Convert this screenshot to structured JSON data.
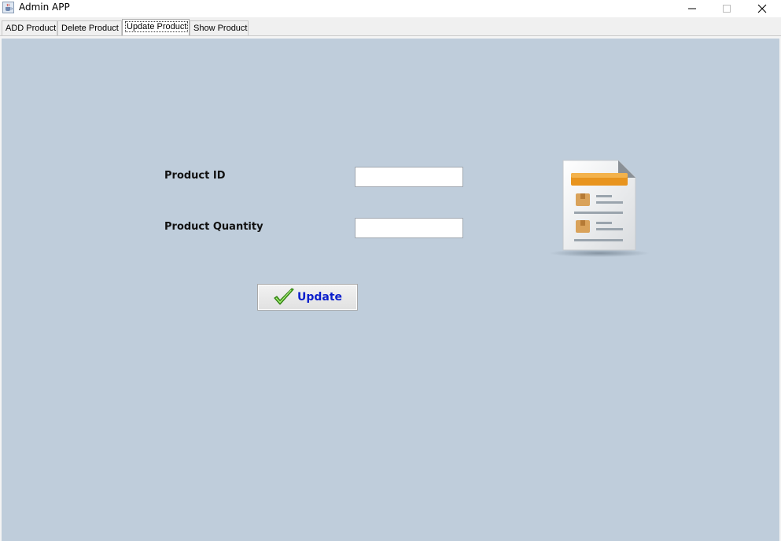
{
  "window": {
    "title": "Admin APP",
    "app_icon": "java-cup-icon",
    "controls": [
      "minimize-icon",
      "maximize-icon",
      "close-icon"
    ]
  },
  "tabs": [
    {
      "label": "ADD Product",
      "active": false
    },
    {
      "label": "Delete Product",
      "active": false
    },
    {
      "label": "Update Product",
      "active": true
    },
    {
      "label": "Show Product",
      "active": false
    }
  ],
  "form": {
    "product_id_label": "Product ID",
    "product_id_value": "",
    "product_quantity_label": "Product Quantity",
    "product_quantity_value": "",
    "update_button_label": "Update",
    "update_button_icon": "checkmark-icon"
  },
  "illustration": "product-document-icon",
  "colors": {
    "panel_background": "#bfcddb",
    "button_text": "#0b1fcc",
    "checkmark": "#5bbf2a",
    "document_header": "#e8941e"
  }
}
